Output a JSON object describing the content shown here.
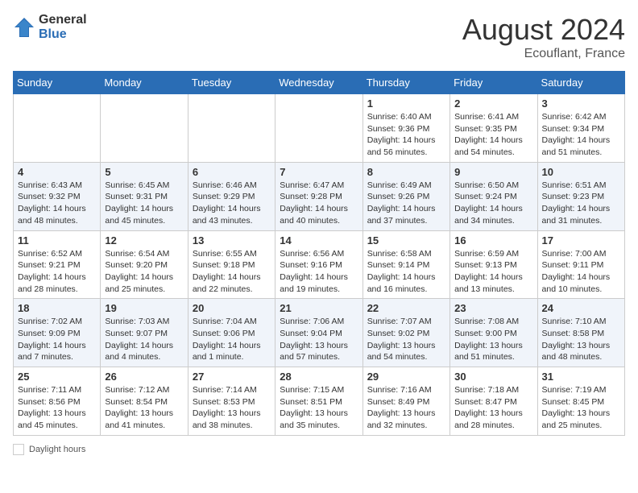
{
  "header": {
    "logo_general": "General",
    "logo_blue": "Blue",
    "month_title": "August 2024",
    "subtitle": "Ecouflant, France"
  },
  "days_of_week": [
    "Sunday",
    "Monday",
    "Tuesday",
    "Wednesday",
    "Thursday",
    "Friday",
    "Saturday"
  ],
  "weeks": [
    [
      {
        "day": "",
        "info": ""
      },
      {
        "day": "",
        "info": ""
      },
      {
        "day": "",
        "info": ""
      },
      {
        "day": "",
        "info": ""
      },
      {
        "day": "1",
        "info": "Sunrise: 6:40 AM\nSunset: 9:36 PM\nDaylight: 14 hours\nand 56 minutes."
      },
      {
        "day": "2",
        "info": "Sunrise: 6:41 AM\nSunset: 9:35 PM\nDaylight: 14 hours\nand 54 minutes."
      },
      {
        "day": "3",
        "info": "Sunrise: 6:42 AM\nSunset: 9:34 PM\nDaylight: 14 hours\nand 51 minutes."
      }
    ],
    [
      {
        "day": "4",
        "info": "Sunrise: 6:43 AM\nSunset: 9:32 PM\nDaylight: 14 hours\nand 48 minutes."
      },
      {
        "day": "5",
        "info": "Sunrise: 6:45 AM\nSunset: 9:31 PM\nDaylight: 14 hours\nand 45 minutes."
      },
      {
        "day": "6",
        "info": "Sunrise: 6:46 AM\nSunset: 9:29 PM\nDaylight: 14 hours\nand 43 minutes."
      },
      {
        "day": "7",
        "info": "Sunrise: 6:47 AM\nSunset: 9:28 PM\nDaylight: 14 hours\nand 40 minutes."
      },
      {
        "day": "8",
        "info": "Sunrise: 6:49 AM\nSunset: 9:26 PM\nDaylight: 14 hours\nand 37 minutes."
      },
      {
        "day": "9",
        "info": "Sunrise: 6:50 AM\nSunset: 9:24 PM\nDaylight: 14 hours\nand 34 minutes."
      },
      {
        "day": "10",
        "info": "Sunrise: 6:51 AM\nSunset: 9:23 PM\nDaylight: 14 hours\nand 31 minutes."
      }
    ],
    [
      {
        "day": "11",
        "info": "Sunrise: 6:52 AM\nSunset: 9:21 PM\nDaylight: 14 hours\nand 28 minutes."
      },
      {
        "day": "12",
        "info": "Sunrise: 6:54 AM\nSunset: 9:20 PM\nDaylight: 14 hours\nand 25 minutes."
      },
      {
        "day": "13",
        "info": "Sunrise: 6:55 AM\nSunset: 9:18 PM\nDaylight: 14 hours\nand 22 minutes."
      },
      {
        "day": "14",
        "info": "Sunrise: 6:56 AM\nSunset: 9:16 PM\nDaylight: 14 hours\nand 19 minutes."
      },
      {
        "day": "15",
        "info": "Sunrise: 6:58 AM\nSunset: 9:14 PM\nDaylight: 14 hours\nand 16 minutes."
      },
      {
        "day": "16",
        "info": "Sunrise: 6:59 AM\nSunset: 9:13 PM\nDaylight: 14 hours\nand 13 minutes."
      },
      {
        "day": "17",
        "info": "Sunrise: 7:00 AM\nSunset: 9:11 PM\nDaylight: 14 hours\nand 10 minutes."
      }
    ],
    [
      {
        "day": "18",
        "info": "Sunrise: 7:02 AM\nSunset: 9:09 PM\nDaylight: 14 hours\nand 7 minutes."
      },
      {
        "day": "19",
        "info": "Sunrise: 7:03 AM\nSunset: 9:07 PM\nDaylight: 14 hours\nand 4 minutes."
      },
      {
        "day": "20",
        "info": "Sunrise: 7:04 AM\nSunset: 9:06 PM\nDaylight: 14 hours\nand 1 minute."
      },
      {
        "day": "21",
        "info": "Sunrise: 7:06 AM\nSunset: 9:04 PM\nDaylight: 13 hours\nand 57 minutes."
      },
      {
        "day": "22",
        "info": "Sunrise: 7:07 AM\nSunset: 9:02 PM\nDaylight: 13 hours\nand 54 minutes."
      },
      {
        "day": "23",
        "info": "Sunrise: 7:08 AM\nSunset: 9:00 PM\nDaylight: 13 hours\nand 51 minutes."
      },
      {
        "day": "24",
        "info": "Sunrise: 7:10 AM\nSunset: 8:58 PM\nDaylight: 13 hours\nand 48 minutes."
      }
    ],
    [
      {
        "day": "25",
        "info": "Sunrise: 7:11 AM\nSunset: 8:56 PM\nDaylight: 13 hours\nand 45 minutes."
      },
      {
        "day": "26",
        "info": "Sunrise: 7:12 AM\nSunset: 8:54 PM\nDaylight: 13 hours\nand 41 minutes."
      },
      {
        "day": "27",
        "info": "Sunrise: 7:14 AM\nSunset: 8:53 PM\nDaylight: 13 hours\nand 38 minutes."
      },
      {
        "day": "28",
        "info": "Sunrise: 7:15 AM\nSunset: 8:51 PM\nDaylight: 13 hours\nand 35 minutes."
      },
      {
        "day": "29",
        "info": "Sunrise: 7:16 AM\nSunset: 8:49 PM\nDaylight: 13 hours\nand 32 minutes."
      },
      {
        "day": "30",
        "info": "Sunrise: 7:18 AM\nSunset: 8:47 PM\nDaylight: 13 hours\nand 28 minutes."
      },
      {
        "day": "31",
        "info": "Sunrise: 7:19 AM\nSunset: 8:45 PM\nDaylight: 13 hours\nand 25 minutes."
      }
    ]
  ],
  "footer": {
    "label": "Daylight hours"
  }
}
